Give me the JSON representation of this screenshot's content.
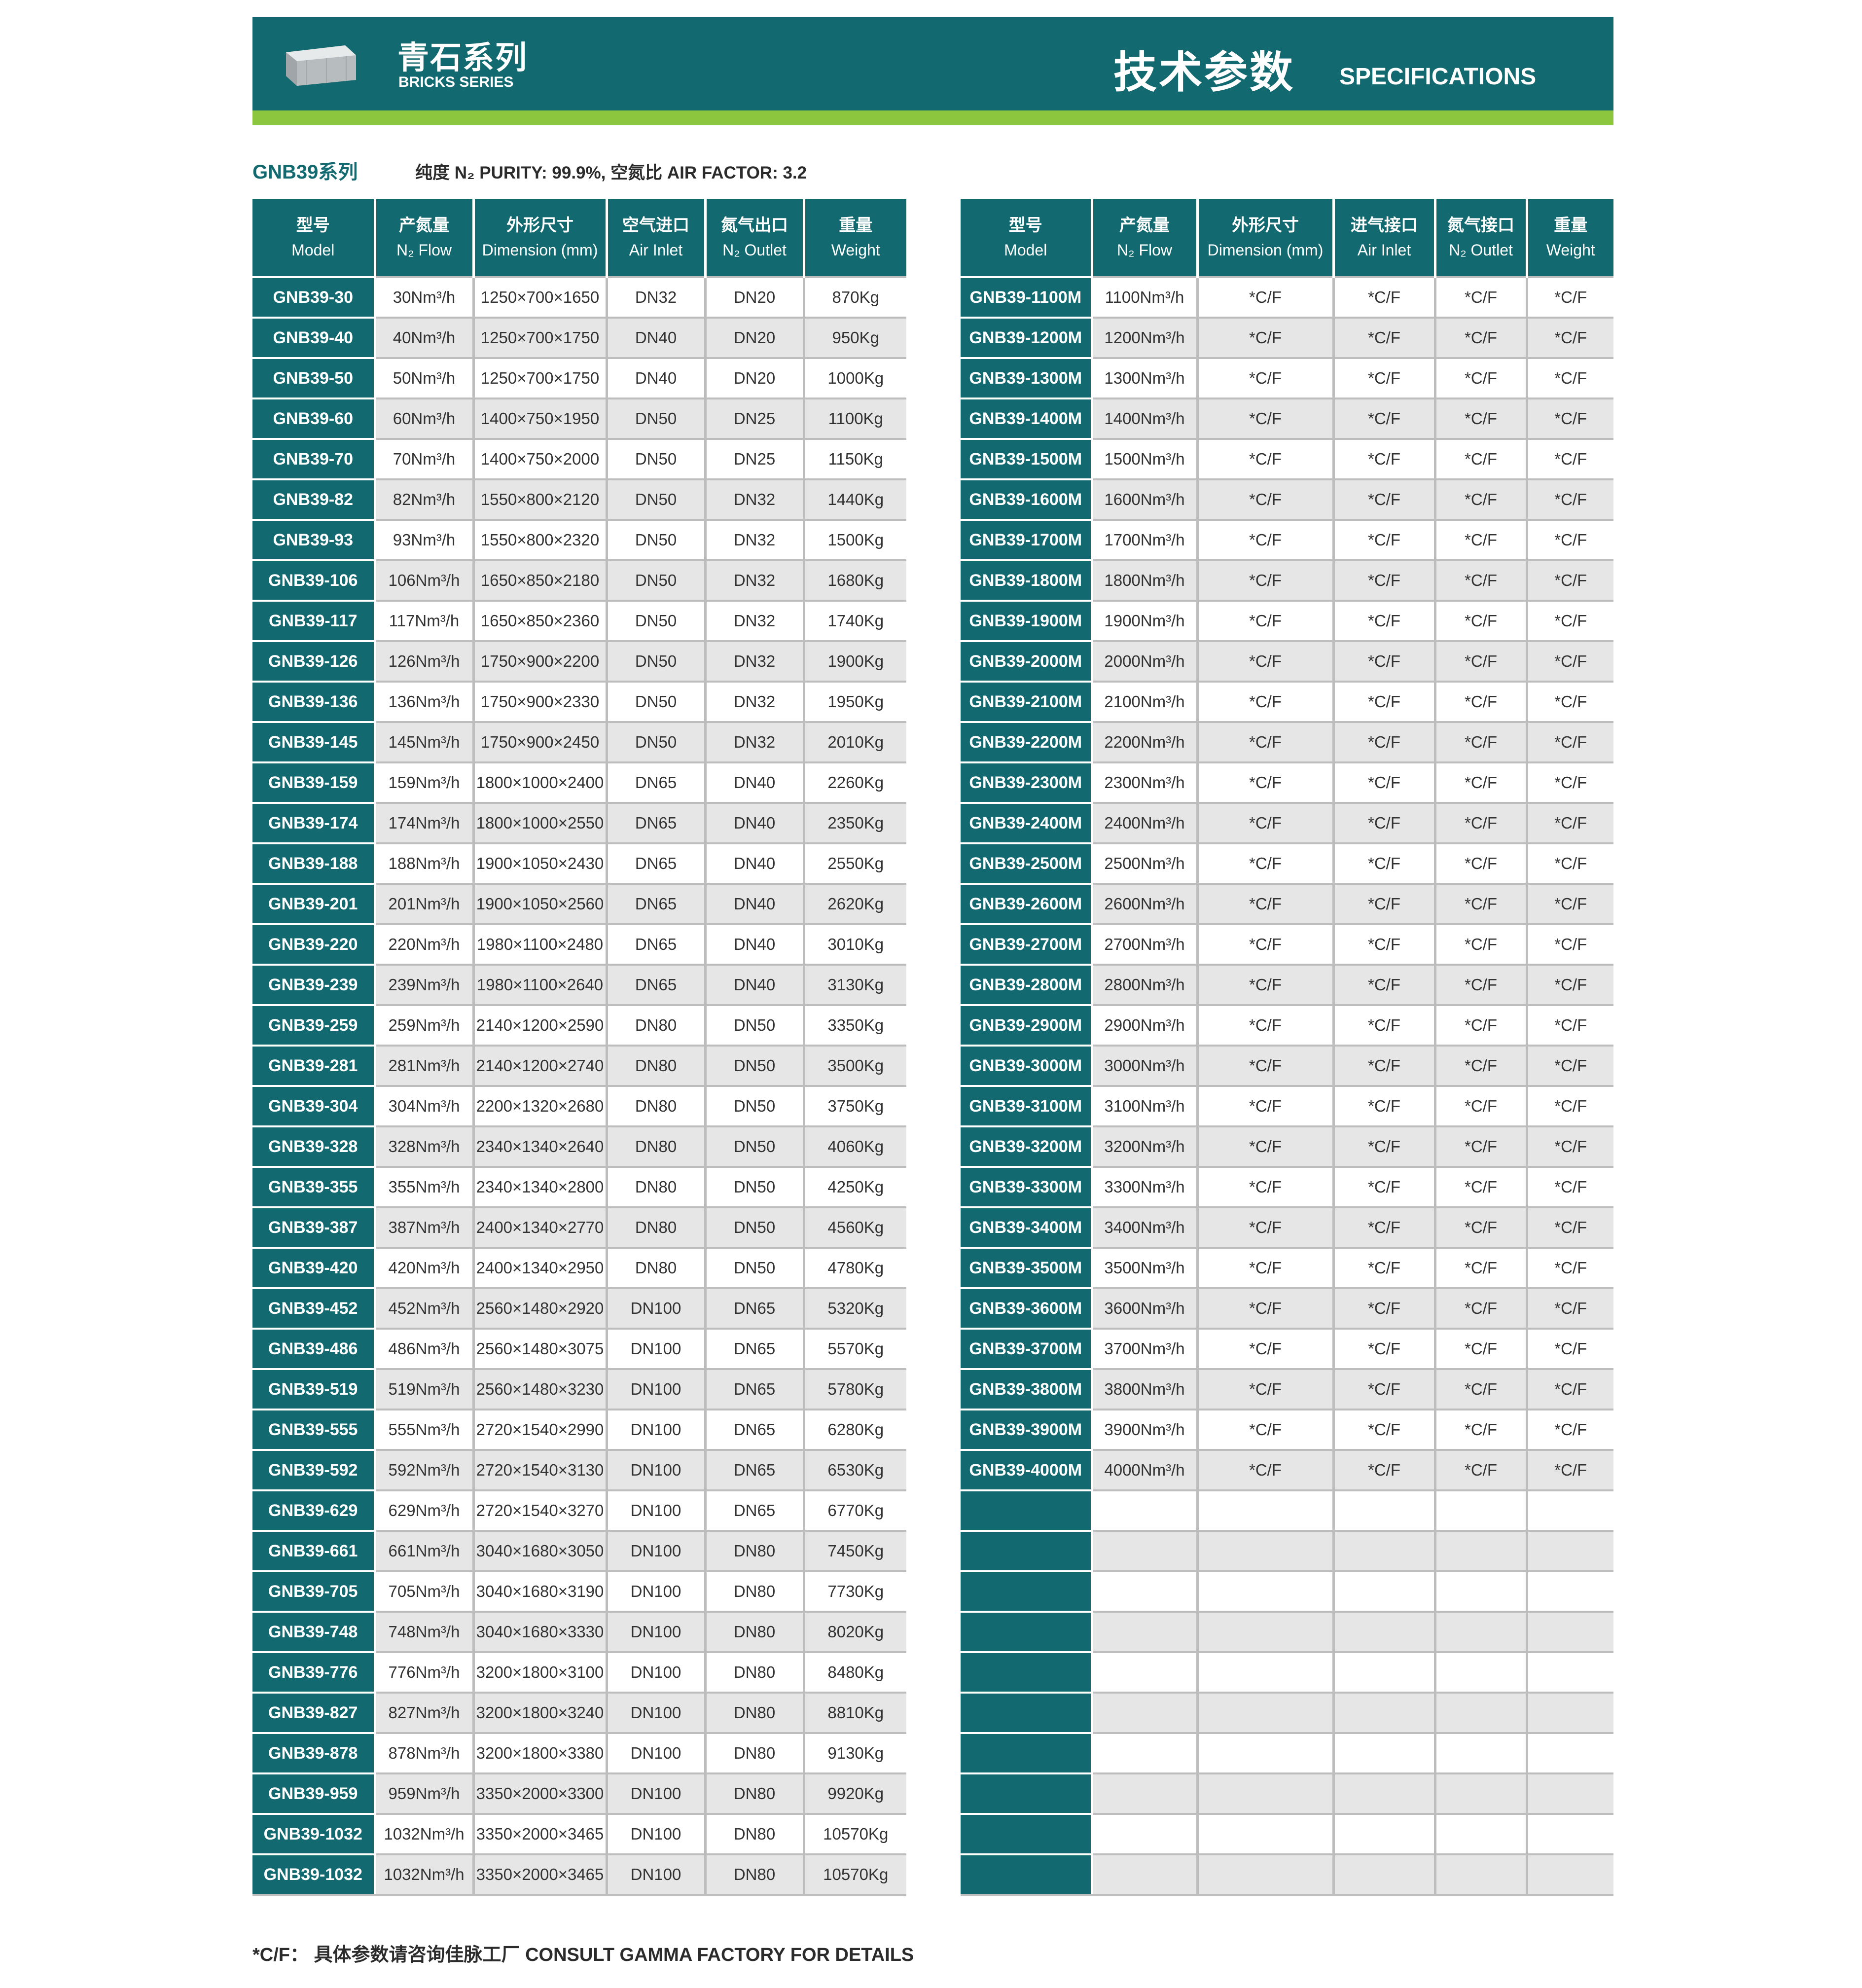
{
  "header": {
    "series_cn": "青石系列",
    "series_en": "BRICKS SERIES",
    "spec_cn": "技术参数",
    "spec_en": "SPECIFICATIONS",
    "logo_icon": "brick-block-icon",
    "colors": {
      "primary": "#12696f",
      "accent": "#8cc63f",
      "row_alt": "#e6e6e6"
    }
  },
  "section": {
    "title": "GNB39系列",
    "purity": "纯度 N₂ PURITY: 99.9%, 空氮比 AIR FACTOR: 3.2"
  },
  "columns_left": [
    {
      "cn": "型号",
      "en": "Model"
    },
    {
      "cn": "产氮量",
      "en": "N₂ Flow"
    },
    {
      "cn": "外形尺寸",
      "en": "Dimension (mm)"
    },
    {
      "cn": "空气进口",
      "en": "Air Inlet"
    },
    {
      "cn": "氮气出口",
      "en": "N₂ Outlet"
    },
    {
      "cn": "重量",
      "en": "Weight"
    }
  ],
  "columns_right": [
    {
      "cn": "型号",
      "en": "Model"
    },
    {
      "cn": "产氮量",
      "en": "N₂ Flow"
    },
    {
      "cn": "外形尺寸",
      "en": "Dimension (mm)"
    },
    {
      "cn": "进气接口",
      "en": "Air Inlet"
    },
    {
      "cn": "氮气接口",
      "en": "N₂ Outlet"
    },
    {
      "cn": "重量",
      "en": "Weight"
    }
  ],
  "rows_left": [
    [
      "GNB39-30",
      "30Nm³/h",
      "1250×700×1650",
      "DN32",
      "DN20",
      "870Kg"
    ],
    [
      "GNB39-40",
      "40Nm³/h",
      "1250×700×1750",
      "DN40",
      "DN20",
      "950Kg"
    ],
    [
      "GNB39-50",
      "50Nm³/h",
      "1250×700×1750",
      "DN40",
      "DN20",
      "1000Kg"
    ],
    [
      "GNB39-60",
      "60Nm³/h",
      "1400×750×1950",
      "DN50",
      "DN25",
      "1100Kg"
    ],
    [
      "GNB39-70",
      "70Nm³/h",
      "1400×750×2000",
      "DN50",
      "DN25",
      "1150Kg"
    ],
    [
      "GNB39-82",
      "82Nm³/h",
      "1550×800×2120",
      "DN50",
      "DN32",
      "1440Kg"
    ],
    [
      "GNB39-93",
      "93Nm³/h",
      "1550×800×2320",
      "DN50",
      "DN32",
      "1500Kg"
    ],
    [
      "GNB39-106",
      "106Nm³/h",
      "1650×850×2180",
      "DN50",
      "DN32",
      "1680Kg"
    ],
    [
      "GNB39-117",
      "117Nm³/h",
      "1650×850×2360",
      "DN50",
      "DN32",
      "1740Kg"
    ],
    [
      "GNB39-126",
      "126Nm³/h",
      "1750×900×2200",
      "DN50",
      "DN32",
      "1900Kg"
    ],
    [
      "GNB39-136",
      "136Nm³/h",
      "1750×900×2330",
      "DN50",
      "DN32",
      "1950Kg"
    ],
    [
      "GNB39-145",
      "145Nm³/h",
      "1750×900×2450",
      "DN50",
      "DN32",
      "2010Kg"
    ],
    [
      "GNB39-159",
      "159Nm³/h",
      "1800×1000×2400",
      "DN65",
      "DN40",
      "2260Kg"
    ],
    [
      "GNB39-174",
      "174Nm³/h",
      "1800×1000×2550",
      "DN65",
      "DN40",
      "2350Kg"
    ],
    [
      "GNB39-188",
      "188Nm³/h",
      "1900×1050×2430",
      "DN65",
      "DN40",
      "2550Kg"
    ],
    [
      "GNB39-201",
      "201Nm³/h",
      "1900×1050×2560",
      "DN65",
      "DN40",
      "2620Kg"
    ],
    [
      "GNB39-220",
      "220Nm³/h",
      "1980×1100×2480",
      "DN65",
      "DN40",
      "3010Kg"
    ],
    [
      "GNB39-239",
      "239Nm³/h",
      "1980×1100×2640",
      "DN65",
      "DN40",
      "3130Kg"
    ],
    [
      "GNB39-259",
      "259Nm³/h",
      "2140×1200×2590",
      "DN80",
      "DN50",
      "3350Kg"
    ],
    [
      "GNB39-281",
      "281Nm³/h",
      "2140×1200×2740",
      "DN80",
      "DN50",
      "3500Kg"
    ],
    [
      "GNB39-304",
      "304Nm³/h",
      "2200×1320×2680",
      "DN80",
      "DN50",
      "3750Kg"
    ],
    [
      "GNB39-328",
      "328Nm³/h",
      "2340×1340×2640",
      "DN80",
      "DN50",
      "4060Kg"
    ],
    [
      "GNB39-355",
      "355Nm³/h",
      "2340×1340×2800",
      "DN80",
      "DN50",
      "4250Kg"
    ],
    [
      "GNB39-387",
      "387Nm³/h",
      "2400×1340×2770",
      "DN80",
      "DN50",
      "4560Kg"
    ],
    [
      "GNB39-420",
      "420Nm³/h",
      "2400×1340×2950",
      "DN80",
      "DN50",
      "4780Kg"
    ],
    [
      "GNB39-452",
      "452Nm³/h",
      "2560×1480×2920",
      "DN100",
      "DN65",
      "5320Kg"
    ],
    [
      "GNB39-486",
      "486Nm³/h",
      "2560×1480×3075",
      "DN100",
      "DN65",
      "5570Kg"
    ],
    [
      "GNB39-519",
      "519Nm³/h",
      "2560×1480×3230",
      "DN100",
      "DN65",
      "5780Kg"
    ],
    [
      "GNB39-555",
      "555Nm³/h",
      "2720×1540×2990",
      "DN100",
      "DN65",
      "6280Kg"
    ],
    [
      "GNB39-592",
      "592Nm³/h",
      "2720×1540×3130",
      "DN100",
      "DN65",
      "6530Kg"
    ],
    [
      "GNB39-629",
      "629Nm³/h",
      "2720×1540×3270",
      "DN100",
      "DN65",
      "6770Kg"
    ],
    [
      "GNB39-661",
      "661Nm³/h",
      "3040×1680×3050",
      "DN100",
      "DN80",
      "7450Kg"
    ],
    [
      "GNB39-705",
      "705Nm³/h",
      "3040×1680×3190",
      "DN100",
      "DN80",
      "7730Kg"
    ],
    [
      "GNB39-748",
      "748Nm³/h",
      "3040×1680×3330",
      "DN100",
      "DN80",
      "8020Kg"
    ],
    [
      "GNB39-776",
      "776Nm³/h",
      "3200×1800×3100",
      "DN100",
      "DN80",
      "8480Kg"
    ],
    [
      "GNB39-827",
      "827Nm³/h",
      "3200×1800×3240",
      "DN100",
      "DN80",
      "8810Kg"
    ],
    [
      "GNB39-878",
      "878Nm³/h",
      "3200×1800×3380",
      "DN100",
      "DN80",
      "9130Kg"
    ],
    [
      "GNB39-959",
      "959Nm³/h",
      "3350×2000×3300",
      "DN100",
      "DN80",
      "9920Kg"
    ],
    [
      "GNB39-1032",
      "1032Nm³/h",
      "3350×2000×3465",
      "DN100",
      "DN80",
      "10570Kg"
    ],
    [
      "GNB39-1032",
      "1032Nm³/h",
      "3350×2000×3465",
      "DN100",
      "DN80",
      "10570Kg"
    ]
  ],
  "rows_right": [
    [
      "GNB39-1100M",
      "1100Nm³/h",
      "*C/F",
      "*C/F",
      "*C/F",
      "*C/F"
    ],
    [
      "GNB39-1200M",
      "1200Nm³/h",
      "*C/F",
      "*C/F",
      "*C/F",
      "*C/F"
    ],
    [
      "GNB39-1300M",
      "1300Nm³/h",
      "*C/F",
      "*C/F",
      "*C/F",
      "*C/F"
    ],
    [
      "GNB39-1400M",
      "1400Nm³/h",
      "*C/F",
      "*C/F",
      "*C/F",
      "*C/F"
    ],
    [
      "GNB39-1500M",
      "1500Nm³/h",
      "*C/F",
      "*C/F",
      "*C/F",
      "*C/F"
    ],
    [
      "GNB39-1600M",
      "1600Nm³/h",
      "*C/F",
      "*C/F",
      "*C/F",
      "*C/F"
    ],
    [
      "GNB39-1700M",
      "1700Nm³/h",
      "*C/F",
      "*C/F",
      "*C/F",
      "*C/F"
    ],
    [
      "GNB39-1800M",
      "1800Nm³/h",
      "*C/F",
      "*C/F",
      "*C/F",
      "*C/F"
    ],
    [
      "GNB39-1900M",
      "1900Nm³/h",
      "*C/F",
      "*C/F",
      "*C/F",
      "*C/F"
    ],
    [
      "GNB39-2000M",
      "2000Nm³/h",
      "*C/F",
      "*C/F",
      "*C/F",
      "*C/F"
    ],
    [
      "GNB39-2100M",
      "2100Nm³/h",
      "*C/F",
      "*C/F",
      "*C/F",
      "*C/F"
    ],
    [
      "GNB39-2200M",
      "2200Nm³/h",
      "*C/F",
      "*C/F",
      "*C/F",
      "*C/F"
    ],
    [
      "GNB39-2300M",
      "2300Nm³/h",
      "*C/F",
      "*C/F",
      "*C/F",
      "*C/F"
    ],
    [
      "GNB39-2400M",
      "2400Nm³/h",
      "*C/F",
      "*C/F",
      "*C/F",
      "*C/F"
    ],
    [
      "GNB39-2500M",
      "2500Nm³/h",
      "*C/F",
      "*C/F",
      "*C/F",
      "*C/F"
    ],
    [
      "GNB39-2600M",
      "2600Nm³/h",
      "*C/F",
      "*C/F",
      "*C/F",
      "*C/F"
    ],
    [
      "GNB39-2700M",
      "2700Nm³/h",
      "*C/F",
      "*C/F",
      "*C/F",
      "*C/F"
    ],
    [
      "GNB39-2800M",
      "2800Nm³/h",
      "*C/F",
      "*C/F",
      "*C/F",
      "*C/F"
    ],
    [
      "GNB39-2900M",
      "2900Nm³/h",
      "*C/F",
      "*C/F",
      "*C/F",
      "*C/F"
    ],
    [
      "GNB39-3000M",
      "3000Nm³/h",
      "*C/F",
      "*C/F",
      "*C/F",
      "*C/F"
    ],
    [
      "GNB39-3100M",
      "3100Nm³/h",
      "*C/F",
      "*C/F",
      "*C/F",
      "*C/F"
    ],
    [
      "GNB39-3200M",
      "3200Nm³/h",
      "*C/F",
      "*C/F",
      "*C/F",
      "*C/F"
    ],
    [
      "GNB39-3300M",
      "3300Nm³/h",
      "*C/F",
      "*C/F",
      "*C/F",
      "*C/F"
    ],
    [
      "GNB39-3400M",
      "3400Nm³/h",
      "*C/F",
      "*C/F",
      "*C/F",
      "*C/F"
    ],
    [
      "GNB39-3500M",
      "3500Nm³/h",
      "*C/F",
      "*C/F",
      "*C/F",
      "*C/F"
    ],
    [
      "GNB39-3600M",
      "3600Nm³/h",
      "*C/F",
      "*C/F",
      "*C/F",
      "*C/F"
    ],
    [
      "GNB39-3700M",
      "3700Nm³/h",
      "*C/F",
      "*C/F",
      "*C/F",
      "*C/F"
    ],
    [
      "GNB39-3800M",
      "3800Nm³/h",
      "*C/F",
      "*C/F",
      "*C/F",
      "*C/F"
    ],
    [
      "GNB39-3900M",
      "3900Nm³/h",
      "*C/F",
      "*C/F",
      "*C/F",
      "*C/F"
    ],
    [
      "GNB39-4000M",
      "4000Nm³/h",
      "*C/F",
      "*C/F",
      "*C/F",
      "*C/F"
    ],
    [
      "",
      "",
      "",
      "",
      "",
      ""
    ],
    [
      "",
      "",
      "",
      "",
      "",
      ""
    ],
    [
      "",
      "",
      "",
      "",
      "",
      ""
    ],
    [
      "",
      "",
      "",
      "",
      "",
      ""
    ],
    [
      "",
      "",
      "",
      "",
      "",
      ""
    ],
    [
      "",
      "",
      "",
      "",
      "",
      ""
    ],
    [
      "",
      "",
      "",
      "",
      "",
      ""
    ],
    [
      "",
      "",
      "",
      "",
      "",
      ""
    ],
    [
      "",
      "",
      "",
      "",
      "",
      ""
    ],
    [
      "",
      "",
      "",
      "",
      "",
      ""
    ]
  ],
  "footnote": "*C/F： 具体参数请咨询佳脉工厂 CONSULT GAMMA FACTORY FOR DETAILS"
}
